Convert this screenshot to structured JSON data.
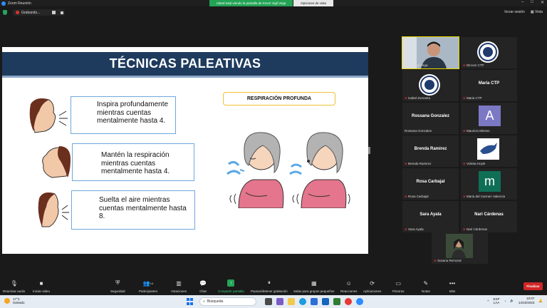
{
  "window": {
    "title": "Zoom Reunión",
    "controls": [
      "–",
      "□",
      "✕"
    ]
  },
  "share_banner": "Usted está viendo la pantalla de Kevin Vigil Vega",
  "view_options": "Opciones de vista",
  "recording": {
    "label": "Grabando..."
  },
  "top_right": {
    "exit_full": "Incrar sesión",
    "view": "Vista"
  },
  "slide": {
    "title": "TÉCNICAS PALEATIVAS",
    "steps": [
      "Inspira profundamente mientras cuentas mentalmente hasta 4.",
      "Mantén la respiración mientras cuentas mentalmente hasta 4.",
      "Suelta el aire mientras cuentas mentalmente hasta 8."
    ],
    "technique_label": "RESPIRACIÓN PROFUNDA"
  },
  "participants": [
    {
      "name": "Kevin Vigil Vega",
      "type": "video"
    },
    {
      "name": "Dircom CTP",
      "type": "logo"
    },
    {
      "name": "Isabel Zumaeta",
      "type": "logo"
    },
    {
      "name": "Maria CTP",
      "display": "Maria CTP",
      "type": "name"
    },
    {
      "name": "Rossana Gonzales",
      "display": "Rossana Gonzalez",
      "type": "name"
    },
    {
      "name": "Mauricio Mieses",
      "avatar": "A",
      "avatar_color": "#7b79c4",
      "type": "avatar"
    },
    {
      "name": "Brenda Ramirez",
      "display": "Brenda Ramirez",
      "type": "name"
    },
    {
      "name": "Violeta Hoyle",
      "type": "bird"
    },
    {
      "name": "Rosa Carbajal",
      "display": "Rosa Carbajal",
      "type": "name"
    },
    {
      "name": "Maria del Carmen Valencia",
      "avatar": "m",
      "avatar_color": "#0f6e56",
      "type": "avatar"
    },
    {
      "name": "Sara Ayala",
      "display": "Sara Ayala",
      "type": "name"
    },
    {
      "name": "Nari Cárdenas",
      "display": "Nari Cárdenas",
      "type": "name"
    },
    {
      "name": "Susana Remond",
      "type": "video2"
    }
  ],
  "toolbar": {
    "items": [
      {
        "label": "Reactivar audio",
        "icon": "mic-muted-icon"
      },
      {
        "label": "Iniciar video",
        "icon": "video-off-icon"
      },
      {
        "label": "Seguridad",
        "icon": "shield-icon"
      },
      {
        "label": "Participantes",
        "icon": "participants-icon",
        "count": "14"
      },
      {
        "label": "Votaciones",
        "icon": "poll-icon"
      },
      {
        "label": "Chat",
        "icon": "chat-icon"
      },
      {
        "label": "Compartir pantalla",
        "icon": "share-icon"
      },
      {
        "label": "Pausar/detener grabación",
        "icon": "record-icon"
      },
      {
        "label": "Salas para grupos pequeños",
        "icon": "breakout-icon"
      },
      {
        "label": "Reacciones",
        "icon": "reactions-icon"
      },
      {
        "label": "Aplicaciones",
        "icon": "apps-icon"
      },
      {
        "label": "Pizarras",
        "icon": "whiteboard-icon"
      },
      {
        "label": "Notas",
        "icon": "notes-icon"
      },
      {
        "label": "Más",
        "icon": "more-icon"
      }
    ],
    "end": "Finalizar"
  },
  "taskbar": {
    "weather_temp": "17°C",
    "weather_desc": "Soleado",
    "search": "Búsqueda",
    "lang1": "ESP",
    "lang2": "LAA",
    "time": "10:07",
    "date": "14/10/2023"
  }
}
